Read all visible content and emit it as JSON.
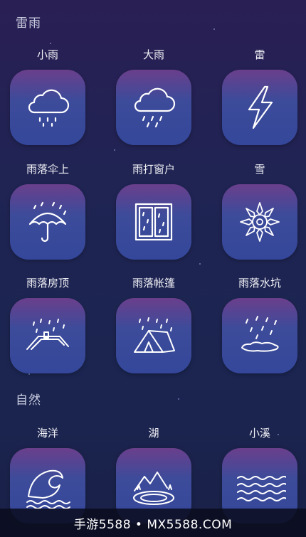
{
  "sections": {
    "rain": "雷雨",
    "nature": "自然"
  },
  "tiles": [
    {
      "label": "小雨",
      "icon": "light-rain-icon"
    },
    {
      "label": "大雨",
      "icon": "heavy-rain-icon"
    },
    {
      "label": "雷",
      "icon": "lightning-icon"
    },
    {
      "label": "雨落伞上",
      "icon": "umbrella-rain-icon"
    },
    {
      "label": "雨打窗户",
      "icon": "window-rain-icon"
    },
    {
      "label": "雪",
      "icon": "snowflake-icon"
    },
    {
      "label": "雨落房顶",
      "icon": "roof-rain-icon"
    },
    {
      "label": "雨落帐篷",
      "icon": "tent-rain-icon"
    },
    {
      "label": "雨落水坑",
      "icon": "puddle-rain-icon"
    },
    {
      "label": "海洋",
      "icon": "ocean-wave-icon"
    },
    {
      "label": "湖",
      "icon": "lake-icon"
    },
    {
      "label": "小溪",
      "icon": "stream-icon"
    }
  ],
  "footer": {
    "watermark": "手游5588 • MX5588.COM"
  }
}
